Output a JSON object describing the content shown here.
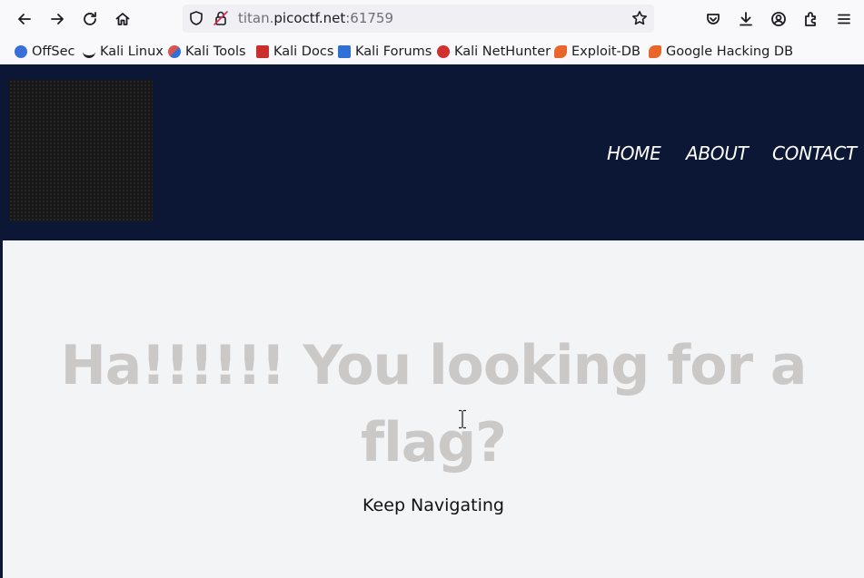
{
  "browser": {
    "url": {
      "subdomain": "titan.",
      "domain": "picoctf.net",
      "port": ":61759"
    },
    "icons": {
      "back": "back-arrow-icon",
      "forward": "forward-arrow-icon",
      "reload": "reload-icon",
      "home": "home-icon",
      "shield": "shield-icon",
      "insecure": "insecure-lock-icon",
      "bookmark": "star-icon",
      "pocket": "pocket-icon",
      "downloads": "download-icon",
      "account": "account-icon",
      "extensions": "extensions-icon",
      "menu": "hamburger-menu-icon"
    },
    "bookmarks": [
      {
        "label": "OffSec",
        "color": "#3a6fd8"
      },
      {
        "label": "Kali Linux",
        "color": "#222222"
      },
      {
        "label": "Kali Tools",
        "color": "#d9534f"
      },
      {
        "label": "Kali Docs",
        "color": "#c9302c"
      },
      {
        "label": "Kali Forums",
        "color": "#2f6fd6"
      },
      {
        "label": "Kali NetHunter",
        "color": "#d22f2f"
      },
      {
        "label": "Exploit-DB",
        "color": "#e8662a"
      },
      {
        "label": "Google Hacking DB",
        "color": "#e8662a"
      }
    ]
  },
  "site": {
    "nav": {
      "home": "HOME",
      "about": "ABOUT",
      "contact": "CONTACT"
    },
    "headline": "Ha!!!!!! You looking for a flag?",
    "subtext": "Keep Navigating",
    "colors": {
      "header_bg": "#0b1734",
      "page_bg": "#f3f4f5",
      "headline": "#cbc9c8"
    }
  }
}
